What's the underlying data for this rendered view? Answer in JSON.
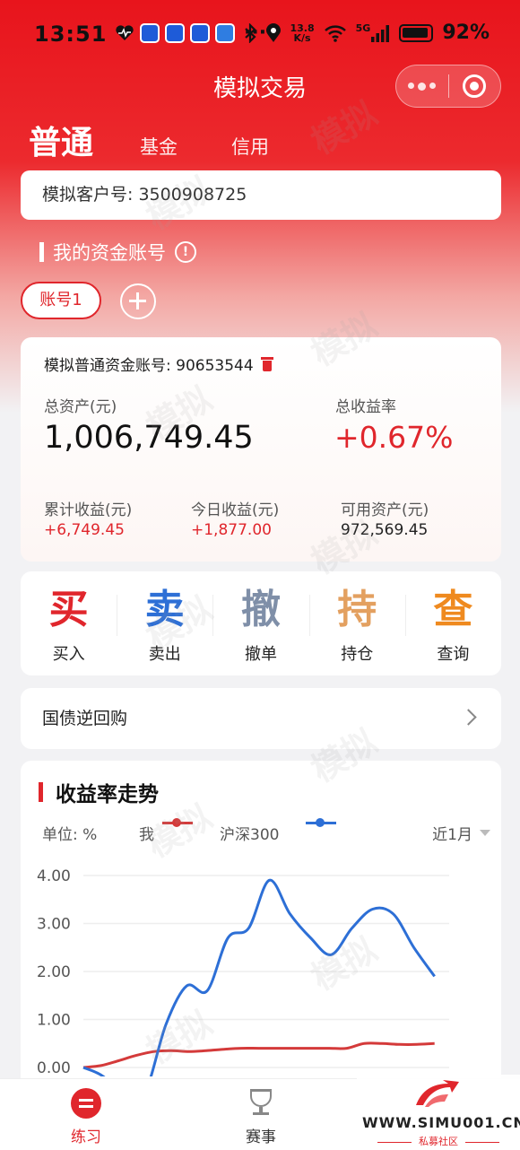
{
  "status_bar": {
    "time": "13:51",
    "more": "···",
    "net_speed_value": "13.8",
    "net_speed_unit": "K/s",
    "network": "5G",
    "battery": "92%"
  },
  "nav": {
    "title": "模拟交易"
  },
  "tabs": {
    "normal": "普通",
    "fund": "基金",
    "credit": "信用"
  },
  "client": {
    "label": "模拟客户号: 3500908725"
  },
  "account_section": {
    "title": "我的资金账号",
    "info": "!",
    "account_tab": "账号1"
  },
  "account": {
    "number_label": "模拟普通资金账号: 90653544",
    "total_assets_label": "总资产(元)",
    "total_assets": "1,006,749.45",
    "total_return_label": "总收益率",
    "total_return": "+0.67%",
    "cum_profit_label": "累计收益(元)",
    "cum_profit": "+6,749.45",
    "today_profit_label": "今日收益(元)",
    "today_profit": "+1,877.00",
    "available_label": "可用资产(元)",
    "available": "972,569.45"
  },
  "actions": [
    {
      "glyph": "买",
      "label": "买入",
      "color": "#e0262c"
    },
    {
      "glyph": "卖",
      "label": "卖出",
      "color": "#2d6fd6"
    },
    {
      "glyph": "撤",
      "label": "撤单",
      "color": "#7f8fa8"
    },
    {
      "glyph": "持",
      "label": "持仓",
      "color": "#e3a060"
    },
    {
      "glyph": "查",
      "label": "查询",
      "color": "#ef8a1f"
    }
  ],
  "repo": {
    "label": "国债逆回购"
  },
  "chart_header": {
    "title": "收益率走势",
    "unit": "单位: %",
    "period": "近1月"
  },
  "chart_data": {
    "type": "line",
    "ylim": [
      0,
      4
    ],
    "yticks": [
      "4.00",
      "3.00",
      "2.00",
      "1.00",
      "0.00"
    ],
    "grid": true,
    "series": [
      {
        "name": "我",
        "color": "#d43a3a",
        "values": [
          0.0,
          0.04,
          0.14,
          0.25,
          0.33,
          0.35,
          0.33,
          0.35,
          0.38,
          0.4,
          0.4,
          0.4,
          0.4,
          0.4,
          0.4,
          0.4,
          0.5,
          0.5,
          0.48,
          0.48,
          0.5
        ]
      },
      {
        "name": "沪深300",
        "color": "#2d6fd6",
        "values": [
          0.0,
          -0.2,
          -0.7,
          -0.5,
          0.9,
          1.7,
          1.6,
          2.7,
          2.9,
          3.9,
          3.2,
          2.7,
          2.35,
          2.9,
          3.3,
          3.2,
          2.5,
          1.9
        ]
      }
    ]
  },
  "bottom_nav": {
    "practice": "练习",
    "contest": "赛事"
  },
  "watermark": {
    "text": "模拟",
    "site": "WWW.SIMU001.CN",
    "community": "私募社区"
  }
}
